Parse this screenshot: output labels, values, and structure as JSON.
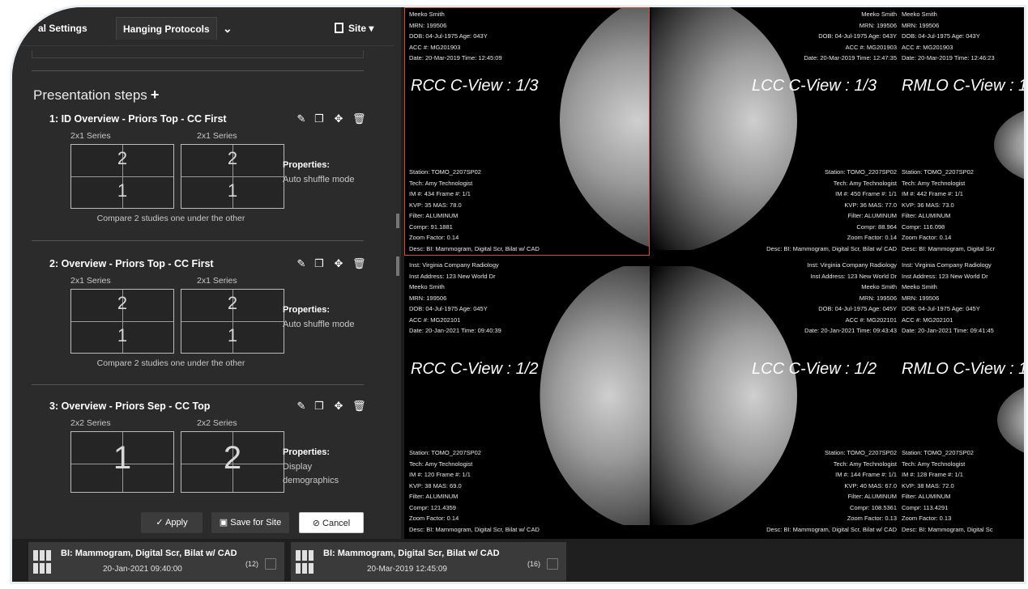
{
  "tabs": {
    "general": "al Settings",
    "hanging": "Hanging Protocols",
    "more": "⌄",
    "site": "Site ▾"
  },
  "presentation": {
    "title": "Presentation steps",
    "add": "+"
  },
  "steps": [
    {
      "title": "1: ID Overview - Priors Top - CC First",
      "series_left": "2x1 Series",
      "series_right": "2x1 Series",
      "left_top": "2",
      "left_bottom": "1",
      "right_top": "2",
      "right_bottom": "1",
      "properties_label": "Properties:",
      "properties_text": "Auto shuffle mode",
      "compare": "Compare 2 studies one under the other"
    },
    {
      "title": "2: Overview - Priors Top - CC First",
      "series_left": "2x1 Series",
      "series_right": "2x1 Series",
      "left_top": "2",
      "left_bottom": "1",
      "right_top": "2",
      "right_bottom": "1",
      "properties_label": "Properties:",
      "properties_text": "Auto shuffle mode",
      "compare": "Compare 2 studies one under the other"
    },
    {
      "title": "3: Overview - Priors Sep - CC Top",
      "series_left": "2x2 Series",
      "series_right": "2x2 Series",
      "left_big": "1",
      "right_big": "2",
      "properties_label": "Properties:",
      "properties_text": "Display demographics"
    }
  ],
  "actions": {
    "apply": "✓ Apply",
    "save": "Save for Site",
    "cancel": "⊘ Cancel"
  },
  "viewports": {
    "tl": {
      "title": "RCC C-View : 1/3",
      "header": "Meeko Smith\nMRN: 199506\nDOB: 04-Jul-1975 Age: 043Y\nACC #: MG201903\nDate: 20-Mar-2019 Time: 12:45:09",
      "footer": "Station: TOMO_2207SP02\nTech: Amy Technologist\nIM #: 434 Frame #: 1/1\nKVP: 35 MAS: 78.0\nFilter: ALUMINUM\nCompr: 91.1881\nZoom Factor: 0.14\nDesc: BI: Mammogram, Digital Scr, Bilat w/ CAD"
    },
    "tm": {
      "title": "LCC C-View : 1/3",
      "header": "Meeko Smith\nMRN: 199506\nDOB: 04-Jul-1975 Age: 043Y\nACC #: MG201903\nDate: 20-Mar-2019 Time: 12:47:35",
      "footer": "Station: TOMO_2207SP02\nTech: Amy Technologist\nIM #: 450 Frame #: 1/1\nKVP: 36 MAS: 77.0\nFilter: ALUMINUM\nCompr: 88.964\nZoom Factor: 0.14\nDesc: BI: Mammogram, Digital Scr, Bilat w/ CAD"
    },
    "tr": {
      "title": "RMLO C-View : 1",
      "header": "Meeko Smith\nMRN: 199506\nDOB: 04-Jul-1975 Age: 043Y\nACC #: MG201903\nDate: 20-Mar-2019 Time: 12:46:23",
      "footer": "Station: TOMO_2207SP02\nTech: Amy Technologist\nIM #: 442 Frame #: 1/1\nKVP: 36 MAS: 73.0\nFilter: ALUMINUM\nCompr: 116.098\nZoom Factor: 0.14\nDesc: BI: Mammogram, Digital Scr"
    },
    "bl": {
      "title": "RCC C-View : 1/2",
      "header": "Inst: Virginia Company Radiology\nInst Address: 123 New World Dr\nMeeko Smith\nMRN: 199506\nDOB: 04-Jul-1975 Age: 045Y\nACC #: MG202101\nDate: 20-Jan-2021 Time: 09:40:39",
      "footer": "Station: TOMO_2207SP02\nTech: Amy Technologist\nIM #: 120 Frame #: 1/1\nKVP: 38 MAS: 69.0\nFilter: ALUMINUM\nCompr: 121.4359\nZoom Factor: 0.14\nDesc: BI: Mammogram, Digital Scr, Bilat w/ CAD"
    },
    "bm": {
      "title": "LCC C-View : 1/2",
      "header": "Inst: Virginia Company Radiology\nInst Address: 123 New World Dr\nMeeko Smith\nMRN: 199506\nDOB: 04-Jul-1975 Age: 045Y\nACC #: MG202101\nDate: 20-Jan-2021 Time: 09:43:43",
      "footer": "Station: TOMO_2207SP02\nTech: Amy Technologist\nIM #: 144 Frame #: 1/1\nKVP: 40 MAS: 67.0\nFilter: ALUMINUM\nCompr: 108.5361\nZoom Factor: 0.13\nDesc: BI: Mammogram, Digital Scr, Bilat w/ CAD"
    },
    "br": {
      "title": "RMLO C-View : 1",
      "header": "Inst: Virginia Company Radiology\nInst Address: 123 New World Dr\nMeeko Smith\nMRN: 199506\nDOB: 04-Jul-1975 Age: 045Y\nACC #: MG202101\nDate: 20-Jan-2021 Time: 09:41:45",
      "footer": "Station: TOMO_2207SP02\nTech: Amy Technologist\nIM #: 128 Frame #: 1/1\nKVP: 38 MAS: 72.0\nFilter: ALUMINUM\nCompr: 113.4291\nZoom Factor: 0.13\nDesc: BI: Mammogram, Digital Sc"
    }
  },
  "studies": [
    {
      "desc": "BI: Mammogram, Digital Scr, Bilat w/ CAD",
      "date": "20-Jan-2021 09:40:00",
      "count": "(12)"
    },
    {
      "desc": "BI: Mammogram, Digital Scr, Bilat w/ CAD",
      "date": "20-Mar-2019 12:45:09",
      "count": "(16)"
    }
  ],
  "colors": {
    "selection_border": "#d05030",
    "panel_bg": "#2b2b2b",
    "viewer_bg": "#000000"
  }
}
